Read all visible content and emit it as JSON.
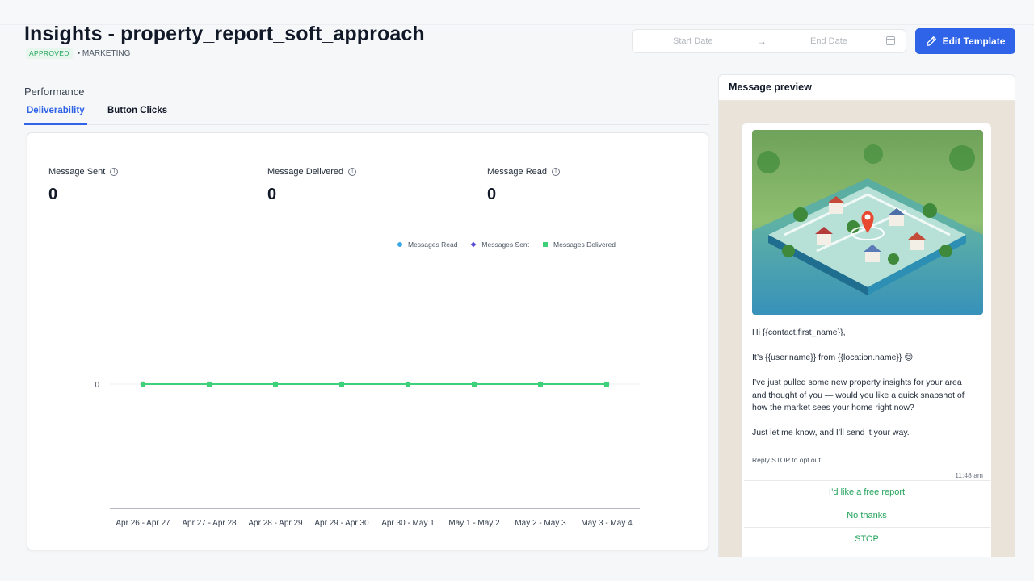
{
  "header": {
    "title": "Insights - property_report_soft_approach",
    "status_badge": "APPROVED",
    "category": "• MARKETING"
  },
  "date_range": {
    "start_placeholder": "Start Date",
    "arrow": "→",
    "end_placeholder": "End Date"
  },
  "edit_button": {
    "label": "Edit Template"
  },
  "performance": {
    "label": "Performance",
    "tabs": [
      {
        "label": "Deliverability",
        "active": true
      },
      {
        "label": "Button Clicks",
        "active": false
      }
    ]
  },
  "metrics": [
    {
      "label": "Message Sent",
      "value": "0"
    },
    {
      "label": "Message Delivered",
      "value": "0"
    },
    {
      "label": "Message Read",
      "value": "0"
    }
  ],
  "colors": {
    "accent": "#2f64e8",
    "series_read": "#3fa7e6",
    "series_sent": "#5b4fd6",
    "series_delivered": "#3ed17a"
  },
  "chart_data": {
    "type": "line",
    "categories": [
      "Apr 26 - Apr 27",
      "Apr 27 - Apr 28",
      "Apr 28 - Apr 29",
      "Apr 29 - Apr 30",
      "Apr 30 - May 1",
      "May 1 - May 2",
      "May 2 - May 3",
      "May 3 - May 4"
    ],
    "series": [
      {
        "name": "Messages Read",
        "values": [
          0,
          0,
          0,
          0,
          0,
          0,
          0,
          0
        ],
        "color": "#3fa7e6",
        "marker": "circle"
      },
      {
        "name": "Messages Sent",
        "values": [
          0,
          0,
          0,
          0,
          0,
          0,
          0,
          0
        ],
        "color": "#5b4fd6",
        "marker": "diamond"
      },
      {
        "name": "Messages Delivered",
        "values": [
          0,
          0,
          0,
          0,
          0,
          0,
          0,
          0
        ],
        "color": "#3ed17a",
        "marker": "square"
      }
    ],
    "yticks": [
      "0"
    ],
    "legend": "top-right",
    "grid": false
  },
  "preview": {
    "title": "Message preview",
    "image_icon": "map-house-illustration",
    "lines": [
      "Hi {{contact.first_name}},",
      "It’s {{user.name}} from {{location.name}} 😊",
      "I’ve just pulled some new property insights for your area and thought of you — would you like a quick snapshot of how the market sees your home right now?",
      "Just let me know, and I’ll send it your way."
    ],
    "footer": "Reply STOP to opt out",
    "time": "11:48 am",
    "buttons": [
      "I’d like a free report",
      "No thanks",
      "STOP"
    ]
  }
}
